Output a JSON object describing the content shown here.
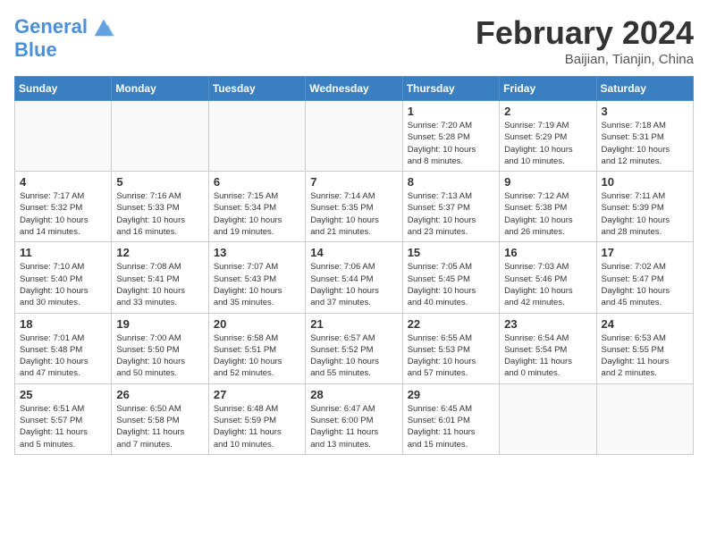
{
  "logo": {
    "line1": "General",
    "line2": "Blue"
  },
  "title": "February 2024",
  "location": "Baijian, Tianjin, China",
  "days_of_week": [
    "Sunday",
    "Monday",
    "Tuesday",
    "Wednesday",
    "Thursday",
    "Friday",
    "Saturday"
  ],
  "weeks": [
    [
      {
        "day": "",
        "info": ""
      },
      {
        "day": "",
        "info": ""
      },
      {
        "day": "",
        "info": ""
      },
      {
        "day": "",
        "info": ""
      },
      {
        "day": "1",
        "info": "Sunrise: 7:20 AM\nSunset: 5:28 PM\nDaylight: 10 hours\nand 8 minutes."
      },
      {
        "day": "2",
        "info": "Sunrise: 7:19 AM\nSunset: 5:29 PM\nDaylight: 10 hours\nand 10 minutes."
      },
      {
        "day": "3",
        "info": "Sunrise: 7:18 AM\nSunset: 5:31 PM\nDaylight: 10 hours\nand 12 minutes."
      }
    ],
    [
      {
        "day": "4",
        "info": "Sunrise: 7:17 AM\nSunset: 5:32 PM\nDaylight: 10 hours\nand 14 minutes."
      },
      {
        "day": "5",
        "info": "Sunrise: 7:16 AM\nSunset: 5:33 PM\nDaylight: 10 hours\nand 16 minutes."
      },
      {
        "day": "6",
        "info": "Sunrise: 7:15 AM\nSunset: 5:34 PM\nDaylight: 10 hours\nand 19 minutes."
      },
      {
        "day": "7",
        "info": "Sunrise: 7:14 AM\nSunset: 5:35 PM\nDaylight: 10 hours\nand 21 minutes."
      },
      {
        "day": "8",
        "info": "Sunrise: 7:13 AM\nSunset: 5:37 PM\nDaylight: 10 hours\nand 23 minutes."
      },
      {
        "day": "9",
        "info": "Sunrise: 7:12 AM\nSunset: 5:38 PM\nDaylight: 10 hours\nand 26 minutes."
      },
      {
        "day": "10",
        "info": "Sunrise: 7:11 AM\nSunset: 5:39 PM\nDaylight: 10 hours\nand 28 minutes."
      }
    ],
    [
      {
        "day": "11",
        "info": "Sunrise: 7:10 AM\nSunset: 5:40 PM\nDaylight: 10 hours\nand 30 minutes."
      },
      {
        "day": "12",
        "info": "Sunrise: 7:08 AM\nSunset: 5:41 PM\nDaylight: 10 hours\nand 33 minutes."
      },
      {
        "day": "13",
        "info": "Sunrise: 7:07 AM\nSunset: 5:43 PM\nDaylight: 10 hours\nand 35 minutes."
      },
      {
        "day": "14",
        "info": "Sunrise: 7:06 AM\nSunset: 5:44 PM\nDaylight: 10 hours\nand 37 minutes."
      },
      {
        "day": "15",
        "info": "Sunrise: 7:05 AM\nSunset: 5:45 PM\nDaylight: 10 hours\nand 40 minutes."
      },
      {
        "day": "16",
        "info": "Sunrise: 7:03 AM\nSunset: 5:46 PM\nDaylight: 10 hours\nand 42 minutes."
      },
      {
        "day": "17",
        "info": "Sunrise: 7:02 AM\nSunset: 5:47 PM\nDaylight: 10 hours\nand 45 minutes."
      }
    ],
    [
      {
        "day": "18",
        "info": "Sunrise: 7:01 AM\nSunset: 5:48 PM\nDaylight: 10 hours\nand 47 minutes."
      },
      {
        "day": "19",
        "info": "Sunrise: 7:00 AM\nSunset: 5:50 PM\nDaylight: 10 hours\nand 50 minutes."
      },
      {
        "day": "20",
        "info": "Sunrise: 6:58 AM\nSunset: 5:51 PM\nDaylight: 10 hours\nand 52 minutes."
      },
      {
        "day": "21",
        "info": "Sunrise: 6:57 AM\nSunset: 5:52 PM\nDaylight: 10 hours\nand 55 minutes."
      },
      {
        "day": "22",
        "info": "Sunrise: 6:55 AM\nSunset: 5:53 PM\nDaylight: 10 hours\nand 57 minutes."
      },
      {
        "day": "23",
        "info": "Sunrise: 6:54 AM\nSunset: 5:54 PM\nDaylight: 11 hours\nand 0 minutes."
      },
      {
        "day": "24",
        "info": "Sunrise: 6:53 AM\nSunset: 5:55 PM\nDaylight: 11 hours\nand 2 minutes."
      }
    ],
    [
      {
        "day": "25",
        "info": "Sunrise: 6:51 AM\nSunset: 5:57 PM\nDaylight: 11 hours\nand 5 minutes."
      },
      {
        "day": "26",
        "info": "Sunrise: 6:50 AM\nSunset: 5:58 PM\nDaylight: 11 hours\nand 7 minutes."
      },
      {
        "day": "27",
        "info": "Sunrise: 6:48 AM\nSunset: 5:59 PM\nDaylight: 11 hours\nand 10 minutes."
      },
      {
        "day": "28",
        "info": "Sunrise: 6:47 AM\nSunset: 6:00 PM\nDaylight: 11 hours\nand 13 minutes."
      },
      {
        "day": "29",
        "info": "Sunrise: 6:45 AM\nSunset: 6:01 PM\nDaylight: 11 hours\nand 15 minutes."
      },
      {
        "day": "",
        "info": ""
      },
      {
        "day": "",
        "info": ""
      }
    ]
  ]
}
